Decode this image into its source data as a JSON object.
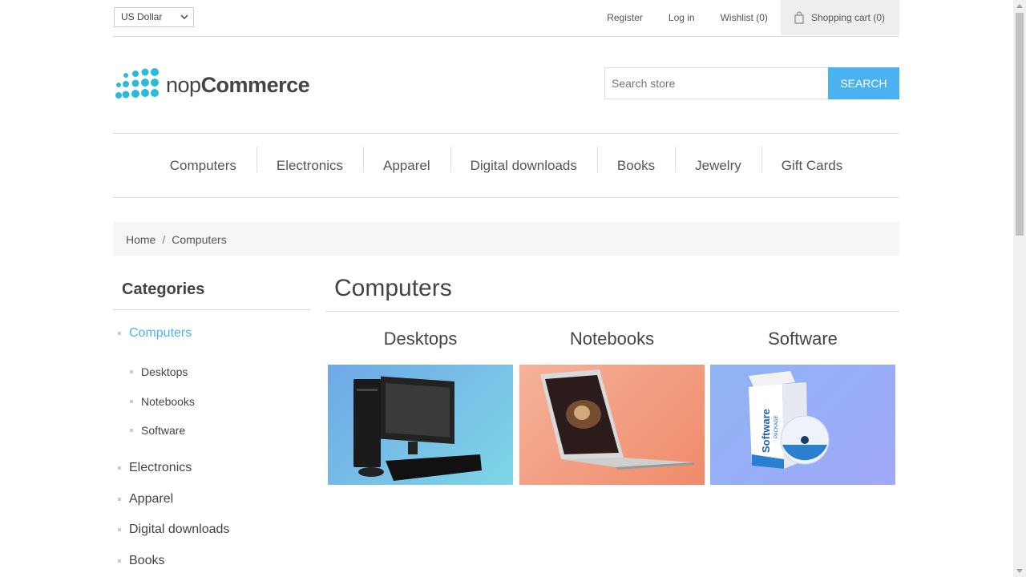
{
  "header": {
    "currency": "US Dollar",
    "links": {
      "register": "Register",
      "login": "Log in",
      "wishlist": "Wishlist (0)",
      "cart": "Shopping cart (0)"
    }
  },
  "logo": {
    "part1": "nop",
    "part2": "Commerce"
  },
  "search": {
    "placeholder": "Search store",
    "button": "Search"
  },
  "menu": [
    "Computers",
    "Electronics",
    "Apparel",
    "Digital downloads",
    "Books",
    "Jewelry",
    "Gift Cards"
  ],
  "breadcrumb": {
    "home": "Home",
    "separator": "/",
    "current": "Computers"
  },
  "sidebar": {
    "title": "Categories",
    "items": [
      {
        "label": "Computers",
        "active": true
      },
      {
        "label": "Desktops"
      },
      {
        "label": "Notebooks"
      },
      {
        "label": "Software"
      },
      {
        "label": "Electronics"
      },
      {
        "label": "Apparel"
      },
      {
        "label": "Digital downloads"
      },
      {
        "label": "Books"
      }
    ]
  },
  "main": {
    "title": "Computers",
    "subcategories": [
      {
        "title": "Desktops"
      },
      {
        "title": "Notebooks"
      },
      {
        "title": "Software"
      }
    ]
  },
  "software_box": {
    "word": "Software",
    "package": "PACKAGE"
  },
  "colors": {
    "accent": "#4ab2f1",
    "logo_dots": "#2bbbd8"
  }
}
